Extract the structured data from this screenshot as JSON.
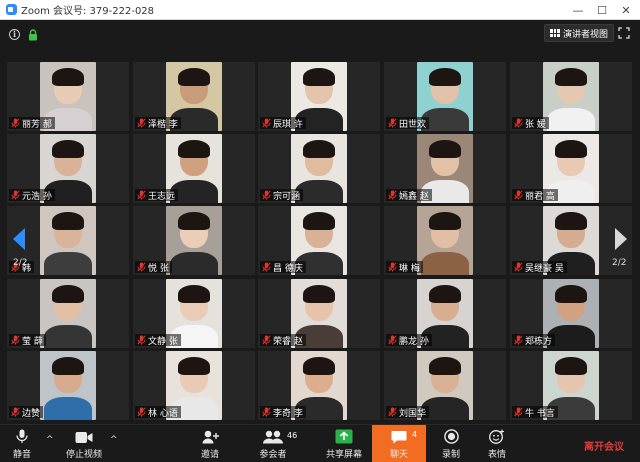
{
  "window": {
    "title": "Zoom 会议号: 379-222-028",
    "controls": [
      "—",
      "☐",
      "✕"
    ]
  },
  "topbar": {
    "speaker_view_label": "演讲者视图"
  },
  "pagination": {
    "left_page": "2/2",
    "right_page": "2/2"
  },
  "participants": [
    {
      "name": "丽芳 郝",
      "row": 0,
      "col": 0,
      "skin": "#e8cbb5",
      "bg": "#c9c2bd",
      "shirt": "#d7d0d3"
    },
    {
      "name": "泽楷 李",
      "row": 0,
      "col": 1,
      "skin": "#c89b7a",
      "bg": "#d4c7a3",
      "shirt": "#2a2a2a"
    },
    {
      "name": "辰琪 许",
      "row": 0,
      "col": 2,
      "skin": "#e4c4ad",
      "bg": "#ece9e3",
      "shirt": "#232323"
    },
    {
      "name": "田世欢",
      "row": 0,
      "col": 3,
      "skin": "#e2c2a8",
      "bg": "#8fd0d0",
      "shirt": "#3a3a3a"
    },
    {
      "name": "张 媛",
      "row": 0,
      "col": 4,
      "skin": "#e6c7b2",
      "bg": "#c7cfc6",
      "shirt": "#f1f1f1"
    },
    {
      "name": "元浩 孙",
      "row": 1,
      "col": 0,
      "skin": "#d8b39a",
      "bg": "#d8d6d3",
      "shirt": "#202020"
    },
    {
      "name": "王志远",
      "row": 1,
      "col": 1,
      "skin": "#cfa17f",
      "bg": "#e6e2dc",
      "shirt": "#242424"
    },
    {
      "name": "宗可涵",
      "row": 1,
      "col": 2,
      "skin": "#e0bc9f",
      "bg": "#e8e4df",
      "shirt": "#2b2b2b"
    },
    {
      "name": "嫣鑫 赵",
      "row": 1,
      "col": 3,
      "skin": "#e2c1a7",
      "bg": "#9b8778",
      "shirt": "#e9e9e9"
    },
    {
      "name": "丽君 高",
      "row": 1,
      "col": 4,
      "skin": "#e8cab4",
      "bg": "#ece8e6",
      "shirt": "#efefef"
    },
    {
      "name": "韩",
      "row": 2,
      "col": 0,
      "skin": "#d9b39a",
      "bg": "#cfc6c0",
      "shirt": "#3d3d3d"
    },
    {
      "name": "悦 张",
      "row": 2,
      "col": 1,
      "skin": "#ebcdb8",
      "bg": "#a7a098",
      "shirt": "#2b2b2b"
    },
    {
      "name": "昌 德庆",
      "row": 2,
      "col": 2,
      "skin": "#d9b196",
      "bg": "#e9e6e2",
      "shirt": "#303030"
    },
    {
      "name": "琳 梅",
      "row": 2,
      "col": 3,
      "skin": "#e1bea4",
      "bg": "#b6a597",
      "shirt": "#8d6244"
    },
    {
      "name": "吴继豪 吴",
      "row": 2,
      "col": 4,
      "skin": "#d6ac90",
      "bg": "#dcd9d6",
      "shirt": "#1f1f1f"
    },
    {
      "name": "莹 薛",
      "row": 3,
      "col": 0,
      "skin": "#e2c0a6",
      "bg": "#c9c5c2",
      "shirt": "#353535"
    },
    {
      "name": "文静 张",
      "row": 3,
      "col": 1,
      "skin": "#e9cbb6",
      "bg": "#e5e1dd",
      "shirt": "#f5f5f5"
    },
    {
      "name": "荣睿 赵",
      "row": 3,
      "col": 2,
      "skin": "#e6c3ab",
      "bg": "#e2ddd8",
      "shirt": "#4a3d38"
    },
    {
      "name": "鹏龙 孙",
      "row": 3,
      "col": 3,
      "skin": "#d8ae90",
      "bg": "#d6d3d0",
      "shirt": "#222222"
    },
    {
      "name": "郑栋方",
      "row": 3,
      "col": 4,
      "skin": "#d0a282",
      "bg": "#aeb1b4",
      "shirt": "#1c1c1c"
    },
    {
      "name": "边赞",
      "row": 4,
      "col": 0,
      "skin": "#d6ab8d",
      "bg": "#bfc4c8",
      "shirt": "#2f6ea8"
    },
    {
      "name": "林 心语",
      "row": 4,
      "col": 1,
      "skin": "#e9cab4",
      "bg": "#e7e2dc",
      "shirt": "#e8e8e8"
    },
    {
      "name": "李奇 李",
      "row": 4,
      "col": 2,
      "skin": "#dcae8e",
      "bg": "#e3d8cf",
      "shirt": "#2a2a2a"
    },
    {
      "name": "刘国华",
      "row": 4,
      "col": 3,
      "skin": "#d8b094",
      "bg": "#cfc9c0",
      "shirt": "#252525"
    },
    {
      "name": "牛 书言",
      "row": 4,
      "col": 4,
      "skin": "#e6c5ae",
      "bg": "#cdd5cf",
      "shirt": "#3b3b3b"
    }
  ],
  "toolbar": {
    "mute_label": "静音",
    "stop_video_label": "停止视频",
    "invite_label": "邀请",
    "participants_label": "参会者",
    "participants_count": "46",
    "share_label": "共享屏幕",
    "chat_label": "聊天",
    "chat_count": "4",
    "record_label": "录制",
    "reactions_label": "表情",
    "leave_label": "离开会议",
    "caret": "^"
  },
  "colors": {
    "accent_blue": "#2d8cff",
    "chat_orange": "#f26d21",
    "share_green": "#29b34a",
    "leave_red": "#e23a3a",
    "mic_off_red": "#e0342f",
    "lock_green": "#3fc44a"
  }
}
